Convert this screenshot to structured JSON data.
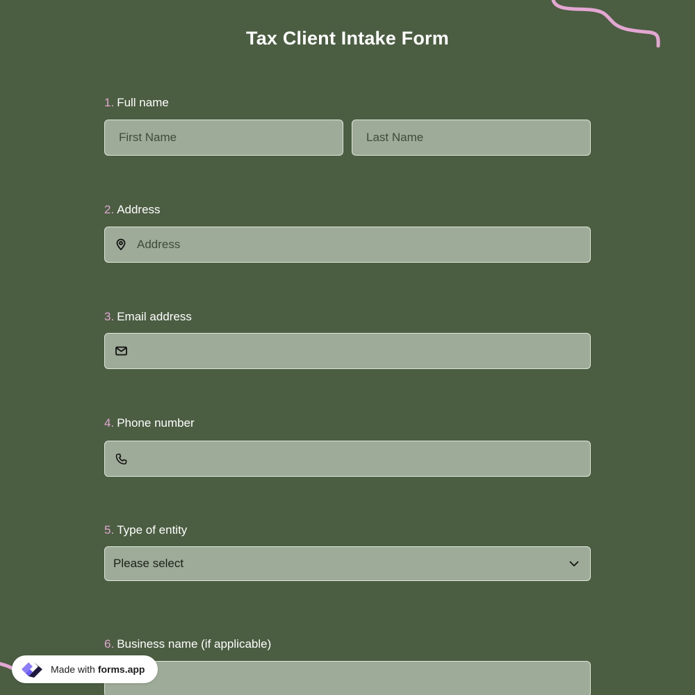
{
  "form": {
    "title": "Tax Client Intake Form"
  },
  "questions": [
    {
      "num": "1.",
      "label": "Full name",
      "first_placeholder": "First Name",
      "last_placeholder": "Last Name"
    },
    {
      "num": "2.",
      "label": "Address",
      "placeholder": "Address",
      "icon": "map-pin-icon"
    },
    {
      "num": "3.",
      "label": "Email address",
      "placeholder": "",
      "icon": "mail-icon"
    },
    {
      "num": "4.",
      "label": "Phone number",
      "placeholder": "",
      "icon": "phone-icon"
    },
    {
      "num": "5.",
      "label": "Type of entity",
      "selected": "Please select",
      "icon": "chevron-down-icon"
    },
    {
      "num": "6.",
      "label": "Business name (if applicable)",
      "placeholder": ""
    }
  ],
  "badge": {
    "prefix": "Made with",
    "brand": "forms.app"
  },
  "colors": {
    "background": "#4b5e42",
    "field": "#9eab98",
    "accent": "#e4a6d3",
    "brand": "#6a5cf5"
  }
}
